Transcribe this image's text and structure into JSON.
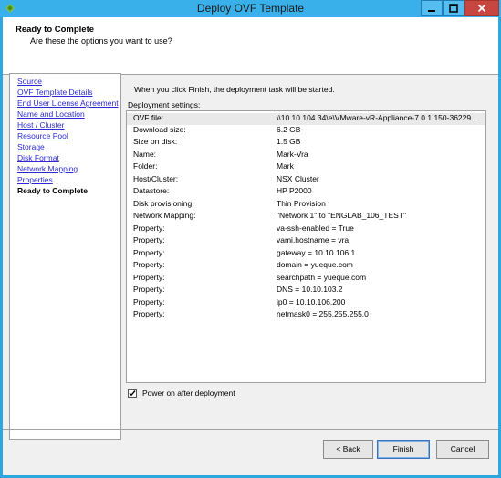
{
  "window": {
    "title": "Deploy OVF Template"
  },
  "header": {
    "title": "Ready to Complete",
    "subtitle": "Are these the options you want to use?"
  },
  "nav": {
    "items": [
      {
        "label": "Source",
        "current": false
      },
      {
        "label": "OVF Template Details",
        "current": false
      },
      {
        "label": "End User License Agreement",
        "current": false
      },
      {
        "label": "Name and Location",
        "current": false
      },
      {
        "label": "Host / Cluster",
        "current": false
      },
      {
        "label": "Resource Pool",
        "current": false
      },
      {
        "label": "Storage",
        "current": false
      },
      {
        "label": "Disk Format",
        "current": false
      },
      {
        "label": "Network Mapping",
        "current": false
      },
      {
        "label": "Properties",
        "current": false
      },
      {
        "label": "Ready to Complete",
        "current": true
      }
    ]
  },
  "main": {
    "intro": "When you click Finish, the deployment task will be started.",
    "settings_label": "Deployment settings:",
    "settings": [
      {
        "key": "OVF file:",
        "value": "\\\\10.10.104.34\\e\\VMware-vR-Appliance-7.0.1.150-36229..."
      },
      {
        "key": "Download size:",
        "value": "6.2 GB"
      },
      {
        "key": "Size on disk:",
        "value": "1.5 GB"
      },
      {
        "key": "Name:",
        "value": "Mark-Vra"
      },
      {
        "key": "Folder:",
        "value": "Mark"
      },
      {
        "key": "Host/Cluster:",
        "value": "NSX Cluster"
      },
      {
        "key": "Datastore:",
        "value": "HP P2000"
      },
      {
        "key": "Disk provisioning:",
        "value": "Thin Provision"
      },
      {
        "key": "Network Mapping:",
        "value": "\"Network 1\" to \"ENGLAB_106_TEST\""
      },
      {
        "key": "Property:",
        "value": "va-ssh-enabled = True"
      },
      {
        "key": "Property:",
        "value": "vami.hostname = vra"
      },
      {
        "key": "Property:",
        "value": "gateway = 10.10.106.1"
      },
      {
        "key": "Property:",
        "value": "domain = yueque.com"
      },
      {
        "key": "Property:",
        "value": "searchpath = yueque.com"
      },
      {
        "key": "Property:",
        "value": "DNS = 10.10.103.2"
      },
      {
        "key": "Property:",
        "value": "ip0 = 10.10.106.200"
      },
      {
        "key": "Property:",
        "value": "netmask0 = 255.255.255.0"
      }
    ],
    "power_on_label": "Power on after deployment",
    "power_on_checked": true
  },
  "buttons": {
    "back": "< Back",
    "finish": "Finish",
    "cancel": "Cancel"
  }
}
